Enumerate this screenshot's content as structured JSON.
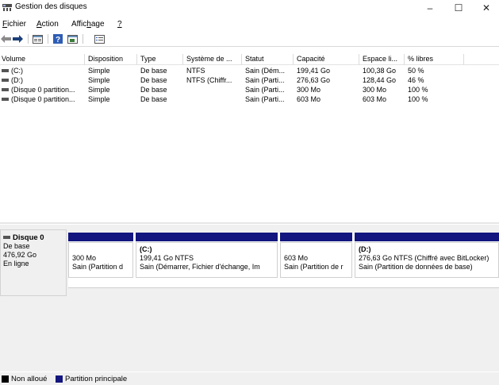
{
  "window": {
    "title": "Gestion des disques",
    "minimize": "–",
    "maximize": "☐",
    "close": "✕"
  },
  "menu": {
    "file": {
      "accel": "F",
      "rest": "ichier"
    },
    "action": {
      "accel": "A",
      "rest": "ction"
    },
    "view": {
      "pre": "Affic",
      "accel": "h",
      "rest": "age"
    },
    "help": {
      "accel": "?"
    }
  },
  "toolbar": {
    "icons": [
      "back-arrow-icon",
      "forward-arrow-icon",
      "properties-icon",
      "help-icon",
      "console-tree-icon",
      "list-view-icon"
    ]
  },
  "volumes_table": {
    "columns": [
      "Volume",
      "Disposition",
      "Type",
      "Système de ...",
      "Statut",
      "Capacité",
      "Espace li...",
      "% libres"
    ],
    "rows": [
      [
        "(C:)",
        "Simple",
        "De base",
        "NTFS",
        "Sain (Dém...",
        "199,41 Go",
        "100,38 Go",
        "50 %"
      ],
      [
        "(D:)",
        "Simple",
        "De base",
        "NTFS (Chiffr...",
        "Sain (Parti...",
        "276,63 Go",
        "128,44 Go",
        "46 %"
      ],
      [
        "(Disque 0 partition...",
        "Simple",
        "De base",
        "",
        "Sain (Parti...",
        "300 Mo",
        "300 Mo",
        "100 %"
      ],
      [
        "(Disque 0 partition...",
        "Simple",
        "De base",
        "",
        "Sain (Parti...",
        "603 Mo",
        "603 Mo",
        "100 %"
      ]
    ]
  },
  "disk": {
    "name": "Disque 0",
    "type": "De base",
    "size": "476,92 Go",
    "status": "En ligne",
    "partitions": [
      {
        "name": "",
        "size": "300 Mo",
        "status": "Sain (Partition d"
      },
      {
        "name": "(C:)",
        "size": "199,41 Go NTFS",
        "status": "Sain (Démarrer, Fichier d'échange, Im"
      },
      {
        "name": "",
        "size": "603 Mo",
        "status": "Sain (Partition de r"
      },
      {
        "name": "(D:)",
        "size": "276,63 Go NTFS (Chiffré avec BitLocker)",
        "status": "Sain (Partition de données de base)"
      }
    ]
  },
  "legend": {
    "unallocated": "Non alloué",
    "primary": "Partition principale"
  },
  "colors": {
    "primary_partition": "#12167e",
    "unallocated": "#000000"
  }
}
